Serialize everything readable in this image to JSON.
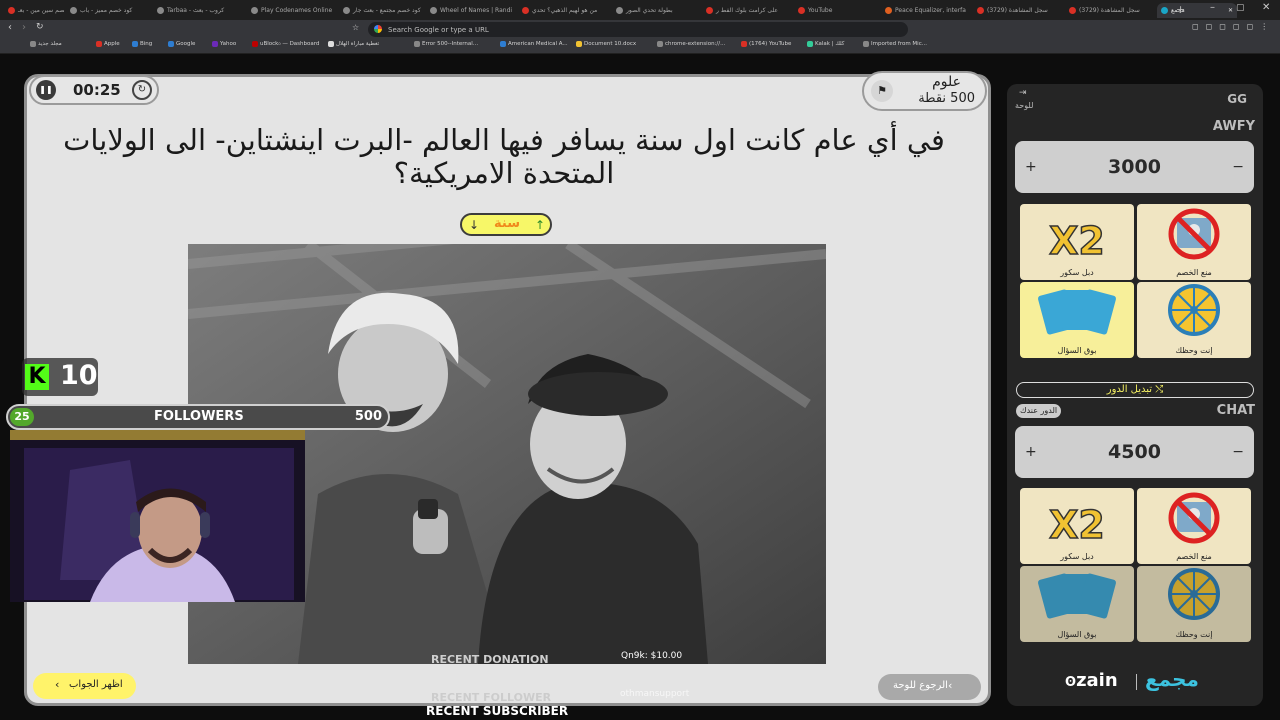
{
  "browser": {
    "tabs": [
      {
        "label": "كود خصم سين مين - بعـ",
        "color": "#d93025"
      },
      {
        "label": "كود خصم مميز - باب",
        "color": "#8a8a8a"
      },
      {
        "label": "Tarbaa - كروب - بعث",
        "color": "#8a8a8a"
      },
      {
        "label": "Play Codenames Online",
        "color": "#8a8a8a"
      },
      {
        "label": "كود خصم مجتمع - بعث جار",
        "color": "#8a8a8a"
      },
      {
        "label": "Wheel of Names | Randi",
        "color": "#8a8a8a"
      },
      {
        "label": "من هو لهيم الذهبي؟ تحدي",
        "color": "#d93025"
      },
      {
        "label": "بطولة تحدي الصور",
        "color": "#8a8a8a"
      },
      {
        "label": "على كرامت بلوك الفط ر",
        "color": "#d93025"
      },
      {
        "label": "YouTube",
        "color": "#d93025"
      },
      {
        "label": "Peace Equalizer, interfa",
        "color": "#e06020"
      },
      {
        "label": "(3729) سجل المشاهدة",
        "color": "#d93025"
      },
      {
        "label": "(3729) سجل المشاهدة",
        "color": "#d93025"
      },
      {
        "label": "مجمع",
        "color": "#1aa6c7"
      }
    ],
    "url_placeholder": "Search Google or type a URL",
    "bookmarks": [
      "مجلد جديد",
      "Apple",
      "Bing",
      "Google",
      "Yahoo",
      "uBlock₀ — Dashboard",
      "تغطية مباراة الهلال",
      "Error 500--Internal...",
      "American Medical A...",
      "Document 10.docx",
      "chrome-extension://...",
      "(1764) YouTube",
      "Kalak | كلك",
      "Imported from Mic..."
    ]
  },
  "game": {
    "timer": "00:25",
    "category": "علوم",
    "points": "500 نقطة",
    "question": "في أي عام كانت اول سنة يسافر فيها العالم -البرت اينشتاين- الى الولايات المتحدة الامريكية؟",
    "answer_type": "سنة",
    "show_answer": "اظهر الجواب",
    "back_to_board": "الرجوع للوحة"
  },
  "panel": {
    "board_label": "للوحة",
    "team_top_tag": "GG",
    "team1": "AWFY",
    "team1_score": "3000",
    "team2": "CHAT",
    "team2_score": "4500",
    "switch_turn": "تبديل الدور",
    "your_turn": "الدور عندك",
    "cards": {
      "double": "دبل سكور",
      "block": "منع الخصم",
      "steal": "بوق السؤال",
      "luck": "إنت وحظك"
    },
    "brand_zain": "zain",
    "brand_logo": "مجمع"
  },
  "stream": {
    "kick_count": "10",
    "followers_label": "FOLLOWERS",
    "followers_left": "25",
    "followers_right": "500",
    "recent_donation": "RECENT DONATION",
    "donation_value": "Qn9k: $10.00",
    "recent_follower": "RECENT FOLLOWER",
    "follower_name": "othmansupport",
    "recent_subscriber": "RECENT SUBSCRIBER"
  },
  "colors": {
    "accent_yellow": "#f7f768",
    "panel_bg": "#252525",
    "kick_green": "#53fc18"
  }
}
